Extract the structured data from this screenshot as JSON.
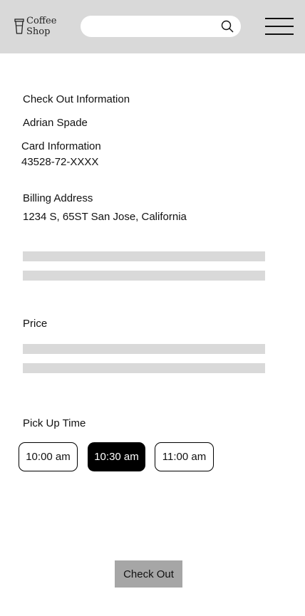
{
  "header": {
    "logo_line1": "Coffee",
    "logo_line2": "Shop",
    "search_value": "",
    "search_icon": "search-icon",
    "menu_icon": "hamburger-menu-icon"
  },
  "checkout_info": {
    "title": "Check Out Information",
    "name": "Adrian Spade",
    "card_label": "Card Information",
    "card_number": "43528-72-XXXX",
    "billing_label": "Billing Address",
    "billing_address": "1234 S, 65ST San Jose, California"
  },
  "price": {
    "label": "Price"
  },
  "pickup": {
    "label": "Pick Up Time",
    "times": [
      "10:00 am",
      "10:30 am",
      "11:00 am"
    ],
    "selected": "10:30 am"
  },
  "checkout_button": {
    "label": "Check Out"
  },
  "colors": {
    "header_bg": "#d9d9d9",
    "placeholder_bar": "#d9d9d9",
    "selected_time_bg": "#000000",
    "checkout_button_bg": "#a6a6a6"
  }
}
